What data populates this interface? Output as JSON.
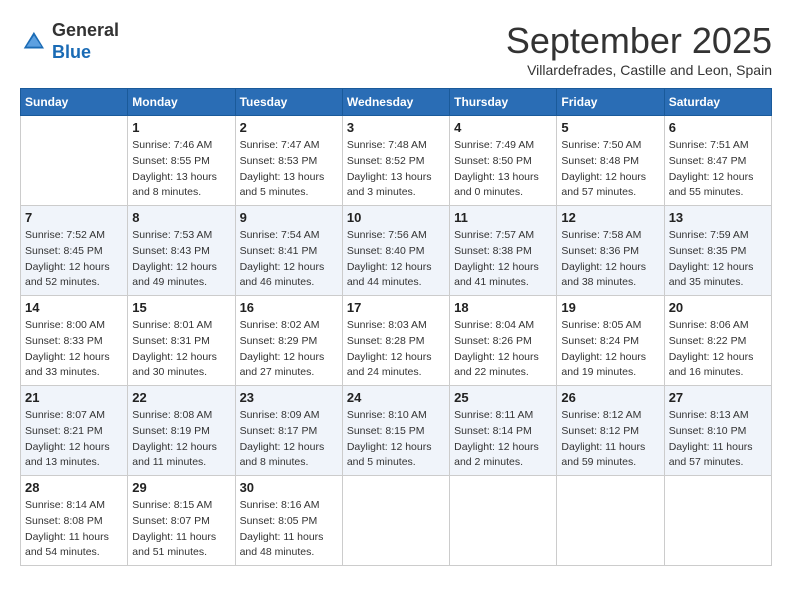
{
  "header": {
    "logo_line1": "General",
    "logo_line2": "Blue",
    "month_title": "September 2025",
    "subtitle": "Villardefrades, Castille and Leon, Spain"
  },
  "days_of_week": [
    "Sunday",
    "Monday",
    "Tuesday",
    "Wednesday",
    "Thursday",
    "Friday",
    "Saturday"
  ],
  "weeks": [
    [
      {
        "day": "",
        "info": ""
      },
      {
        "day": "1",
        "info": "Sunrise: 7:46 AM\nSunset: 8:55 PM\nDaylight: 13 hours\nand 8 minutes."
      },
      {
        "day": "2",
        "info": "Sunrise: 7:47 AM\nSunset: 8:53 PM\nDaylight: 13 hours\nand 5 minutes."
      },
      {
        "day": "3",
        "info": "Sunrise: 7:48 AM\nSunset: 8:52 PM\nDaylight: 13 hours\nand 3 minutes."
      },
      {
        "day": "4",
        "info": "Sunrise: 7:49 AM\nSunset: 8:50 PM\nDaylight: 13 hours\nand 0 minutes."
      },
      {
        "day": "5",
        "info": "Sunrise: 7:50 AM\nSunset: 8:48 PM\nDaylight: 12 hours\nand 57 minutes."
      },
      {
        "day": "6",
        "info": "Sunrise: 7:51 AM\nSunset: 8:47 PM\nDaylight: 12 hours\nand 55 minutes."
      }
    ],
    [
      {
        "day": "7",
        "info": "Sunrise: 7:52 AM\nSunset: 8:45 PM\nDaylight: 12 hours\nand 52 minutes."
      },
      {
        "day": "8",
        "info": "Sunrise: 7:53 AM\nSunset: 8:43 PM\nDaylight: 12 hours\nand 49 minutes."
      },
      {
        "day": "9",
        "info": "Sunrise: 7:54 AM\nSunset: 8:41 PM\nDaylight: 12 hours\nand 46 minutes."
      },
      {
        "day": "10",
        "info": "Sunrise: 7:56 AM\nSunset: 8:40 PM\nDaylight: 12 hours\nand 44 minutes."
      },
      {
        "day": "11",
        "info": "Sunrise: 7:57 AM\nSunset: 8:38 PM\nDaylight: 12 hours\nand 41 minutes."
      },
      {
        "day": "12",
        "info": "Sunrise: 7:58 AM\nSunset: 8:36 PM\nDaylight: 12 hours\nand 38 minutes."
      },
      {
        "day": "13",
        "info": "Sunrise: 7:59 AM\nSunset: 8:35 PM\nDaylight: 12 hours\nand 35 minutes."
      }
    ],
    [
      {
        "day": "14",
        "info": "Sunrise: 8:00 AM\nSunset: 8:33 PM\nDaylight: 12 hours\nand 33 minutes."
      },
      {
        "day": "15",
        "info": "Sunrise: 8:01 AM\nSunset: 8:31 PM\nDaylight: 12 hours\nand 30 minutes."
      },
      {
        "day": "16",
        "info": "Sunrise: 8:02 AM\nSunset: 8:29 PM\nDaylight: 12 hours\nand 27 minutes."
      },
      {
        "day": "17",
        "info": "Sunrise: 8:03 AM\nSunset: 8:28 PM\nDaylight: 12 hours\nand 24 minutes."
      },
      {
        "day": "18",
        "info": "Sunrise: 8:04 AM\nSunset: 8:26 PM\nDaylight: 12 hours\nand 22 minutes."
      },
      {
        "day": "19",
        "info": "Sunrise: 8:05 AM\nSunset: 8:24 PM\nDaylight: 12 hours\nand 19 minutes."
      },
      {
        "day": "20",
        "info": "Sunrise: 8:06 AM\nSunset: 8:22 PM\nDaylight: 12 hours\nand 16 minutes."
      }
    ],
    [
      {
        "day": "21",
        "info": "Sunrise: 8:07 AM\nSunset: 8:21 PM\nDaylight: 12 hours\nand 13 minutes."
      },
      {
        "day": "22",
        "info": "Sunrise: 8:08 AM\nSunset: 8:19 PM\nDaylight: 12 hours\nand 11 minutes."
      },
      {
        "day": "23",
        "info": "Sunrise: 8:09 AM\nSunset: 8:17 PM\nDaylight: 12 hours\nand 8 minutes."
      },
      {
        "day": "24",
        "info": "Sunrise: 8:10 AM\nSunset: 8:15 PM\nDaylight: 12 hours\nand 5 minutes."
      },
      {
        "day": "25",
        "info": "Sunrise: 8:11 AM\nSunset: 8:14 PM\nDaylight: 12 hours\nand 2 minutes."
      },
      {
        "day": "26",
        "info": "Sunrise: 8:12 AM\nSunset: 8:12 PM\nDaylight: 11 hours\nand 59 minutes."
      },
      {
        "day": "27",
        "info": "Sunrise: 8:13 AM\nSunset: 8:10 PM\nDaylight: 11 hours\nand 57 minutes."
      }
    ],
    [
      {
        "day": "28",
        "info": "Sunrise: 8:14 AM\nSunset: 8:08 PM\nDaylight: 11 hours\nand 54 minutes."
      },
      {
        "day": "29",
        "info": "Sunrise: 8:15 AM\nSunset: 8:07 PM\nDaylight: 11 hours\nand 51 minutes."
      },
      {
        "day": "30",
        "info": "Sunrise: 8:16 AM\nSunset: 8:05 PM\nDaylight: 11 hours\nand 48 minutes."
      },
      {
        "day": "",
        "info": ""
      },
      {
        "day": "",
        "info": ""
      },
      {
        "day": "",
        "info": ""
      },
      {
        "day": "",
        "info": ""
      }
    ]
  ]
}
